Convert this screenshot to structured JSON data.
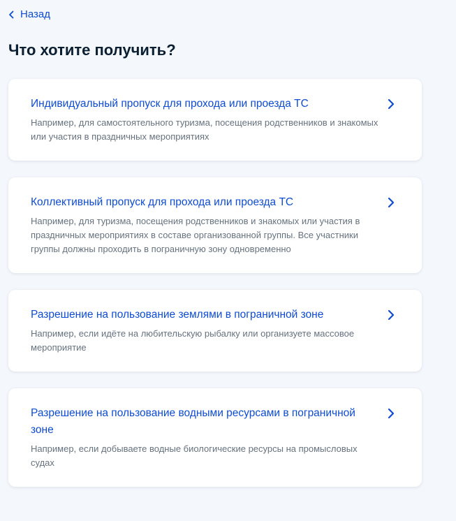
{
  "nav": {
    "back_label": "Назад"
  },
  "page": {
    "title": "Что хотите получить?"
  },
  "options": [
    {
      "title": "Индивидуальный пропуск для прохода или проезда ТС",
      "description": "Например, для самостоятельного туризма, посещения родственников и знакомых или участия в праздничных мероприятиях"
    },
    {
      "title": "Коллективный пропуск для прохода или проезда ТС",
      "description": "Например, для туризма, посещения родственников и знакомых или участия в праздничных мероприятиях в составе организованной группы. Все участники группы должны проходить в пограничную зону одновременно"
    },
    {
      "title": "Разрешение на пользование землями в пограничной зоне",
      "description": "Например, если идёте на любительскую рыбалку или организуете массовое мероприятие"
    },
    {
      "title": "Разрешение на пользование водными ресурсами в пограничной зоне",
      "description": "Например, если добываете водные биологические ресурсы на промысловых судах"
    }
  ],
  "icons": {
    "back": "chevron-left-icon",
    "option_arrow": "chevron-right-icon"
  },
  "colors": {
    "background": "#f4f7fc",
    "link": "#0d4cd3",
    "title_text": "#0b1f33",
    "secondary_text": "#66727f",
    "card": "#ffffff"
  }
}
